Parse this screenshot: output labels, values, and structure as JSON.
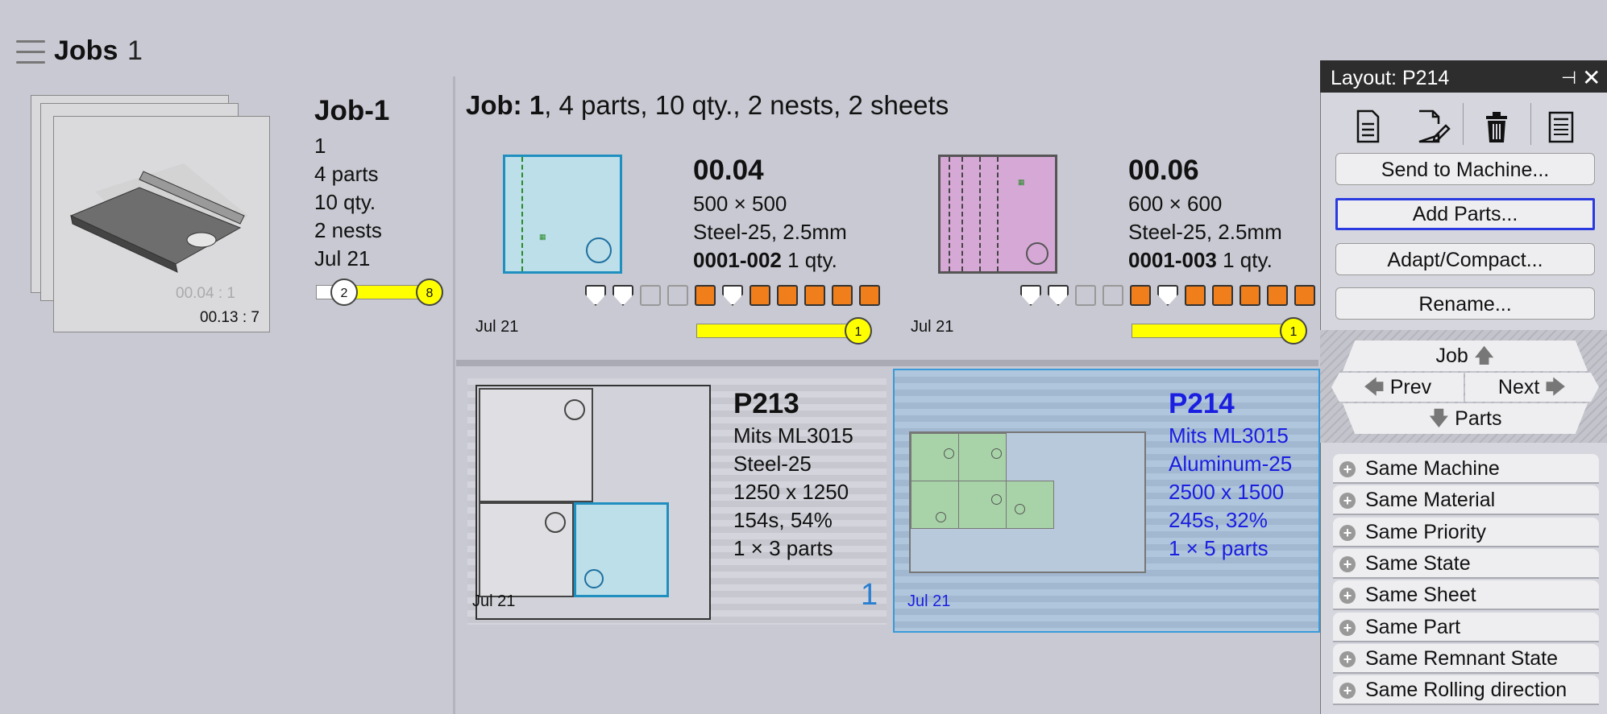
{
  "header": {
    "title": "Jobs",
    "count": "1"
  },
  "job_card": {
    "thumb_faded_label": "00.04 : 1",
    "thumb_label": "00.13 : 7",
    "title": "Job-1",
    "lines": [
      "1",
      "4 parts",
      "10 qty.",
      "2 nests",
      "Jul 21"
    ],
    "progress_start": "2",
    "progress_end": "8"
  },
  "job_info": {
    "prefix": "Job:",
    "number": "1",
    "rest": ", 4 parts, 10 qty., 2 nests, 2 sheets"
  },
  "parts": [
    {
      "name": "00.04",
      "size": "500 × 500",
      "material": "Steel-25, 2.5mm",
      "part_id": "0001-002",
      "qty": "1 qty.",
      "date": "Jul 21",
      "progress_value": "1",
      "thumb_color": "#bcdfe9"
    },
    {
      "name": "00.06",
      "size": "600 × 600",
      "material": "Steel-25, 2.5mm",
      "part_id": "0001-003",
      "qty": "1 qty.",
      "date": "Jul 21",
      "progress_value": "1",
      "thumb_color": "#d6a8d6"
    }
  ],
  "nests": [
    {
      "name": "P213",
      "machine": "Mits ML3015",
      "material": "Steel-25",
      "size": "1250 x 1250",
      "stats": "154s, 54%",
      "parts": "1 × 3 parts",
      "date": "Jul 21",
      "count": "1"
    },
    {
      "name": "P214",
      "machine": "Mits ML3015",
      "material": "Aluminum-25",
      "size": "2500 x 1500",
      "stats": "245s, 32%",
      "parts": "1 × 5 parts",
      "date": "Jul 21"
    }
  ],
  "panel": {
    "title": "Layout: P214",
    "icons": [
      "document-icon",
      "edit-document-icon",
      "trash-icon",
      "report-icon"
    ],
    "buttons": {
      "send": "Send to Machine...",
      "add": "Add Parts...",
      "adapt": "Adapt/Compact...",
      "rename": "Rename..."
    },
    "nav": {
      "job": "Job",
      "prev": "Prev",
      "next": "Next",
      "parts": "Parts"
    },
    "filters": [
      "Same Machine",
      "Same Material",
      "Same Priority",
      "Same State",
      "Same Sheet",
      "Same Part",
      "Same Remnant State",
      "Same Rolling direction"
    ]
  },
  "colors": {
    "accent": "#1a1ee0",
    "progress": "#ffff00",
    "tool_orange": "#f07e1a",
    "selection": "#3a9ad8"
  }
}
